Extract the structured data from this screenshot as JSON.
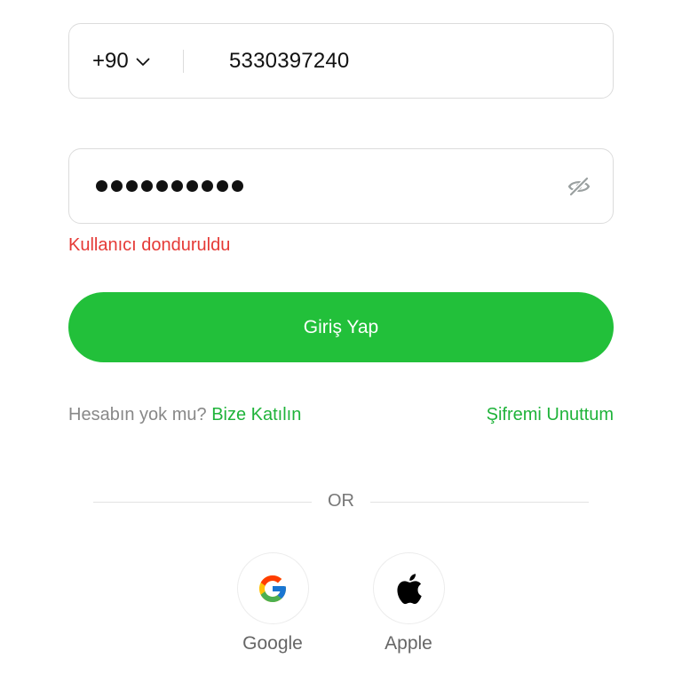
{
  "phone": {
    "country_code": "+90",
    "number": "5330397240"
  },
  "password": {
    "masked_length": 10,
    "toggle_icon": "eye-off-icon"
  },
  "error_message": "Kullanıcı donduruldu",
  "login_button": "Giriş Yap",
  "signup": {
    "prompt": "Hesabın yok mu?",
    "link": "Bize Katılın"
  },
  "forgot_password": "Şifremi Unuttum",
  "divider_text": "OR",
  "social": {
    "google_label": "Google",
    "apple_label": "Apple"
  },
  "colors": {
    "accent": "#22c03a",
    "link": "#1fb33a",
    "error": "#e53935"
  }
}
